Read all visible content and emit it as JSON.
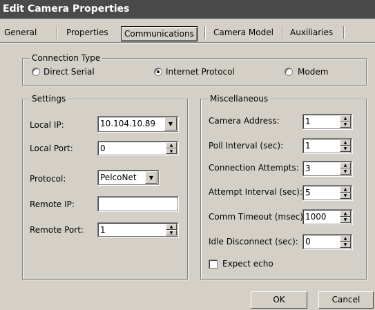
{
  "window": {
    "title": "Edit Camera Properties"
  },
  "tabs": [
    "General",
    "Properties",
    "Communications",
    "Camera Model",
    "Auxiliaries"
  ],
  "connection": {
    "legend": "Connection Type",
    "options": [
      "Direct Serial",
      "Internet Protocol",
      "Modem"
    ],
    "selected": "Internet Protocol"
  },
  "settings": {
    "legend": "Settings",
    "local_ip_label": "Local IP:",
    "local_ip_value": "10.104.10.89",
    "local_port_label": "Local Port:",
    "local_port_value": "0",
    "protocol_label": "Protocol:",
    "protocol_value": "PelcoNet",
    "remote_ip_label": "Remote IP:",
    "remote_ip_value": "",
    "remote_port_label": "Remote Port:",
    "remote_port_value": "1"
  },
  "misc": {
    "legend": "Miscellaneous",
    "camera_address_label": "Camera Address:",
    "camera_address_value": "1",
    "poll_interval_label": "Poll Interval (sec):",
    "poll_interval_value": "1",
    "connection_attempts_label": "Connection Attempts:",
    "connection_attempts_value": "3",
    "attempt_interval_label": "Attempt Interval (sec):",
    "attempt_interval_value": "5",
    "comm_timeout_label": "Comm Timeout (msec):",
    "comm_timeout_value": "1000",
    "idle_disconnect_label": "Idle Disconnect (sec):",
    "idle_disconnect_value": "0",
    "expect_echo_label": "Expect echo",
    "expect_echo_checked": false
  },
  "buttons": {
    "ok": "OK",
    "cancel": "Cancel"
  }
}
